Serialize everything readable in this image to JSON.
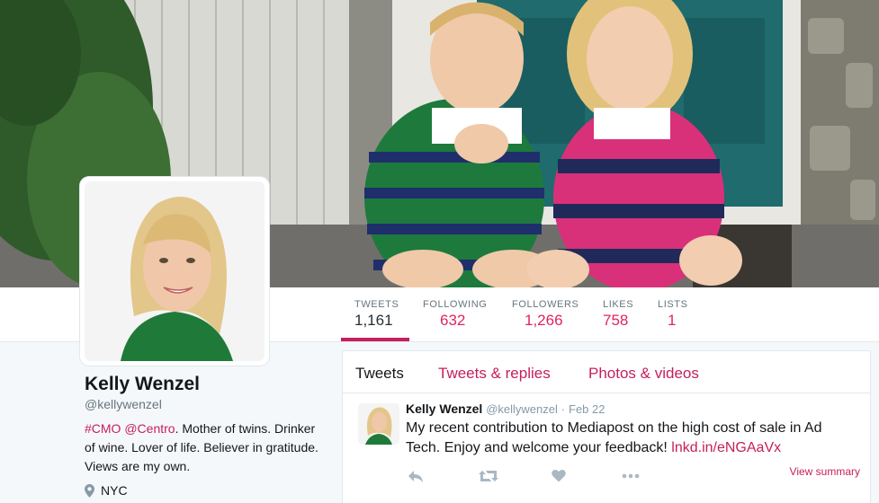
{
  "profile": {
    "name": "Kelly Wenzel",
    "handle": "@kellywenzel",
    "bio": {
      "tag1": "#CMO",
      "tag2": "@Centro",
      "rest": ". Mother of twins. Drinker of wine. Lover of life. Believer in gratitude. Views are my own."
    },
    "location": "NYC",
    "location_icon": "map-pin-icon"
  },
  "stats": [
    {
      "label": "TWEETS",
      "value": "1,161",
      "active": true
    },
    {
      "label": "FOLLOWING",
      "value": "632",
      "active": false
    },
    {
      "label": "FOLLOWERS",
      "value": "1,266",
      "active": false
    },
    {
      "label": "LIKES",
      "value": "758",
      "active": false
    },
    {
      "label": "LISTS",
      "value": "1",
      "active": false
    }
  ],
  "timeline_tabs": [
    {
      "label": "Tweets",
      "active": true
    },
    {
      "label": "Tweets & replies",
      "active": false
    },
    {
      "label": "Photos & videos",
      "active": false
    }
  ],
  "tweet": {
    "name": "Kelly Wenzel",
    "handle": "@kellywenzel",
    "separator": "·",
    "date": "Feb 22",
    "text": "My recent contribution to Mediapost on the high cost of sale in Ad Tech. Enjoy and welcome your feedback! ",
    "link": "lnkd.in/eNGAaVx",
    "view_summary": "View summary",
    "actions": [
      "reply-icon",
      "retweet-icon",
      "like-icon",
      "more-icon"
    ]
  },
  "colors": {
    "accent": "#c51f5d",
    "muted": "#66757f",
    "background": "#f5f8fa"
  }
}
